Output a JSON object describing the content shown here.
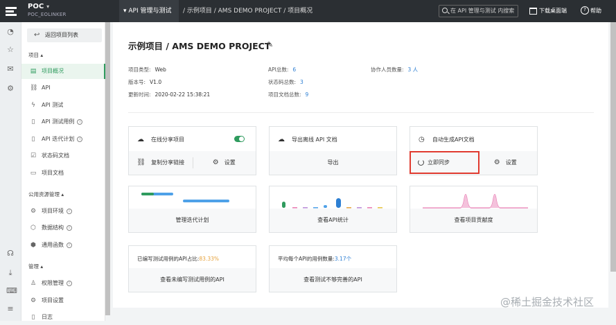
{
  "topbar": {
    "project_name": "POC",
    "project_sub": "POC_EOLINKER",
    "module_tab": "API 管理与测试",
    "breadcrumb": "/ 示例项目 / AMS DEMO PROJECT / 项目概况",
    "search_placeholder": "在 API 管理与测试 内搜索",
    "download_label": "下载桌面端",
    "help_label": "帮助"
  },
  "sidebar": {
    "back_label": "返回项目列表",
    "group_project": "项目 ▴",
    "group_public": "公用资源管理 ▴",
    "group_manage": "管理 ▴",
    "items": [
      {
        "label": "项目概况",
        "icon": "overview-icon"
      },
      {
        "label": "API",
        "icon": "link-icon"
      },
      {
        "label": "API 测试",
        "icon": "bolt-icon"
      },
      {
        "label": "API 测试用例",
        "icon": "testcase-icon"
      },
      {
        "label": "API 迭代计划",
        "icon": "plan-icon"
      },
      {
        "label": "状态码文档",
        "icon": "statuscode-icon"
      },
      {
        "label": "项目文档",
        "icon": "document-icon"
      },
      {
        "label": "项目环境",
        "icon": "environment-icon"
      },
      {
        "label": "数据结构",
        "icon": "datastructure-icon"
      },
      {
        "label": "通用函数",
        "icon": "function-icon"
      },
      {
        "label": "权限管理",
        "icon": "permission-icon"
      },
      {
        "label": "项目设置",
        "icon": "settings-icon"
      },
      {
        "label": "日志",
        "icon": "log-icon"
      }
    ]
  },
  "main": {
    "title": "示例项目 / AMS DEMO PROJECT",
    "meta": {
      "project_type_label": "项目类型:",
      "project_type_value": "Web",
      "version_label": "版本号:",
      "version_value": "V1.0",
      "updated_label": "更新时间:",
      "updated_value": "2020-02-22 15:38:21",
      "api_total_label": "API总数:",
      "api_total_value": "6",
      "status_code_label": "状态码总数:",
      "status_code_value": "3",
      "doc_total_label": "项目文档总数:",
      "doc_total_value": "9",
      "collab_label": "协作人员数量:",
      "collab_value": "3 人"
    },
    "cards": {
      "share_title": "在线分享项目",
      "share_copy": "复制分享链接",
      "share_settings": "设置",
      "export_title": "导出离线 API 文档",
      "export_action": "导出",
      "autogen_title": "自动生成API文档",
      "autogen_sync": "立即同步",
      "autogen_settings": "设置",
      "iteration_action": "管理迭代计划",
      "api_stats_action": "查看API统计",
      "contrib_action": "查看项目贡献度",
      "coverage_text": "已编写测试用例的API占比:",
      "coverage_value": "83.33%",
      "coverage_action": "查看未编写测试用例的API",
      "avg_text": "平均每个API的用例数量:",
      "avg_value": "3.17个",
      "avg_action": "查看测试不够完善的API"
    }
  },
  "watermark": "@稀土掘金技术社区",
  "colors": {
    "accent": "#2f9b5e",
    "link": "#2d7fd3",
    "warning": "#e6a23c",
    "highlight": "#e03a2f",
    "pink_chart": "#e879b0"
  }
}
